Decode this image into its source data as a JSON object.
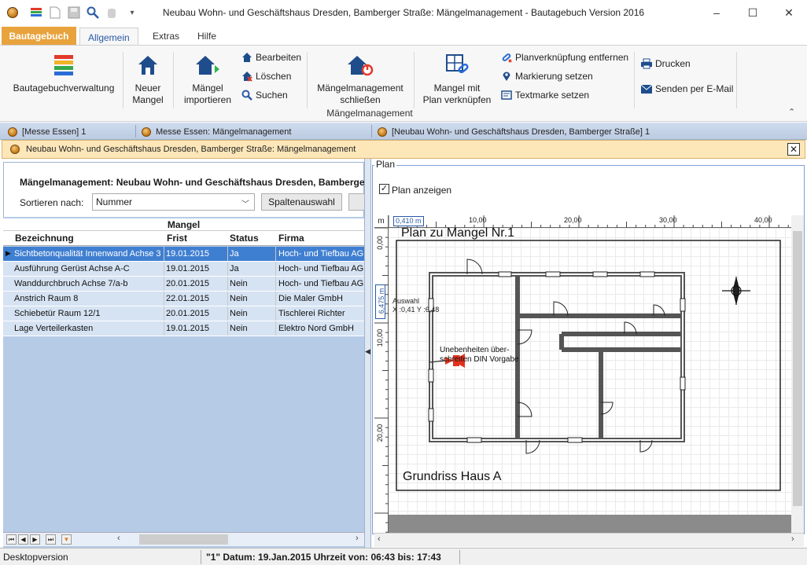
{
  "window": {
    "title": "Neubau Wohn- und Geschäftshaus Dresden, Bamberger Straße: Mängelmanagement - Bautagebuch Version 2016",
    "controls": {
      "minimize": "–",
      "maximize": "☐",
      "close": "✕"
    }
  },
  "ribbon": {
    "file_tab": "Bautagebuch",
    "tabs": [
      "Allgemein",
      "Extras",
      "Hilfe"
    ],
    "buttons": {
      "bautagebuchverwaltung": "Bautagebuchverwaltung",
      "neuer_mangel": [
        "Neuer",
        "Mangel"
      ],
      "maengel_importieren": [
        "Mängel",
        "importieren"
      ],
      "bearbeiten": "Bearbeiten",
      "loeschen": "Löschen",
      "suchen": "Suchen",
      "mm_schliessen": [
        "Mängelmanagement",
        "schließen"
      ],
      "mangel_verknuepfen": [
        "Mangel mit",
        "Plan verknüpfen"
      ],
      "planverknuepfung_entfernen": "Planverknüpfung entfernen",
      "markierung_setzen": "Markierung setzen",
      "textmarke_setzen": "Textmarke setzen",
      "drucken": "Drucken",
      "senden_email": "Senden per E-Mail"
    },
    "group_label": "Mängelmanagement"
  },
  "doc_tabs": [
    "[Messe Essen]  1",
    "Messe Essen: Mängelmanagement",
    "[Neubau Wohn- und Geschäftshaus Dresden, Bamberger Straße]  1"
  ],
  "doc_window_title": "Neubau Wohn- und Geschäftshaus Dresden, Bamberger Straße: Mängelmanagement",
  "left": {
    "title": "Mängelmanagement: Neubau Wohn- und Geschäftshaus Dresden, Bamberger",
    "sort_label": "Sortieren nach:",
    "sort_value": "Nummer",
    "spalten_button": "Spaltenauswahl",
    "band_header": "Mangel",
    "columns": [
      "Bezeichnung",
      "Frist",
      "Status",
      "Firma"
    ],
    "rows": [
      {
        "bez": "Sichtbetonqualität Innenwand Achse 3",
        "frist": "19.01.2015",
        "status": "Ja",
        "firma": "Hoch- und Tiefbau AG"
      },
      {
        "bez": "Ausführung Gerüst Achse A-C",
        "frist": "19.01.2015",
        "status": "Ja",
        "firma": "Hoch- und Tiefbau AG"
      },
      {
        "bez": "Wanddurchbruch Achse 7/a-b",
        "frist": "20.01.2015",
        "status": "Nein",
        "firma": "Hoch- und Tiefbau AG"
      },
      {
        "bez": "Anstrich Raum 8",
        "frist": "22.01.2015",
        "status": "Nein",
        "firma": "Die Maler GmbH"
      },
      {
        "bez": "Schiebetür Raum 12/1",
        "frist": "20.01.2015",
        "status": "Nein",
        "firma": "Tischlerei Richter"
      },
      {
        "bez": "Lage Verteilerkasten",
        "frist": "19.01.2015",
        "status": "Nein",
        "firma": "Elektro Nord  GmbH"
      }
    ]
  },
  "plan": {
    "group_label": "Plan",
    "show_label": "Plan anzeigen",
    "unit": "m",
    "ruler_top_marker": "0,410 m",
    "ruler_top_ticks": [
      "10,00",
      "20,00",
      "30,00",
      "40,00"
    ],
    "ruler_left_marker": "6,475 m",
    "ruler_left_ticks": [
      "0,00",
      "10,00",
      "20,00"
    ],
    "sheet_title": "Plan zu Mangel Nr.1",
    "sheet_footer": "Grundriss Haus A",
    "auswahl_label": "Auswahl",
    "auswahl_coords": "X :0,41 Y :6,48",
    "annotation": [
      "Unebenheiten über-",
      "schreiten DIN Vorgabe"
    ]
  },
  "status": {
    "mode": "Desktopversion",
    "info": "\"1\"  Datum: 19.Jan.2015  Uhrzeit von: 06:43  bis: 17:43"
  },
  "colors": {
    "file_tab": "#e8a33d",
    "selection": "#3f7fd1",
    "grid_bg": "#b5cbe6",
    "pin": "#e2321e"
  }
}
